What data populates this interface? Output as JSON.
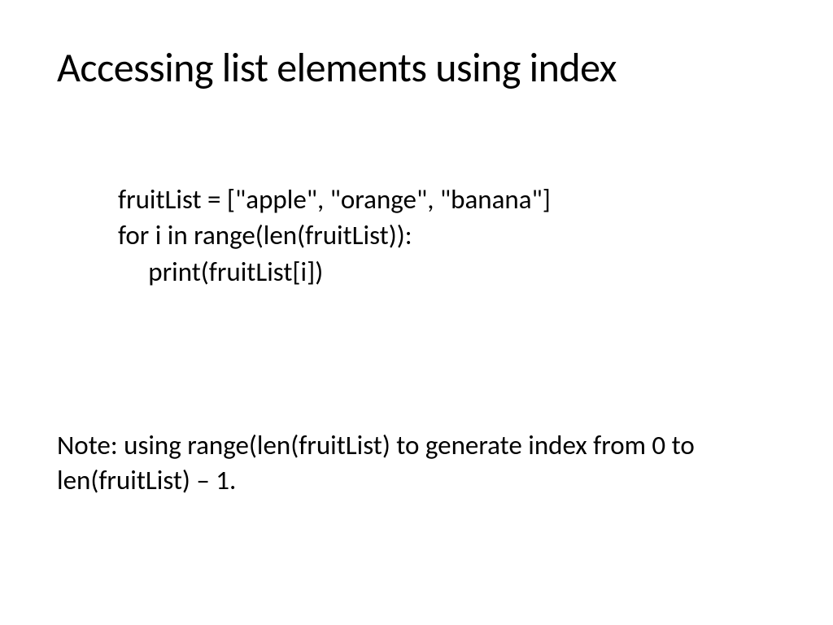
{
  "title": "Accessing list elements using index",
  "code": "fruitList = [\"apple\", \"orange\", \"banana\"]\nfor i in range(len(fruitList)):\n     print(fruitList[i])",
  "note": "Note: using range(len(fruitList) to generate index from 0 to len(fruitList) – 1."
}
